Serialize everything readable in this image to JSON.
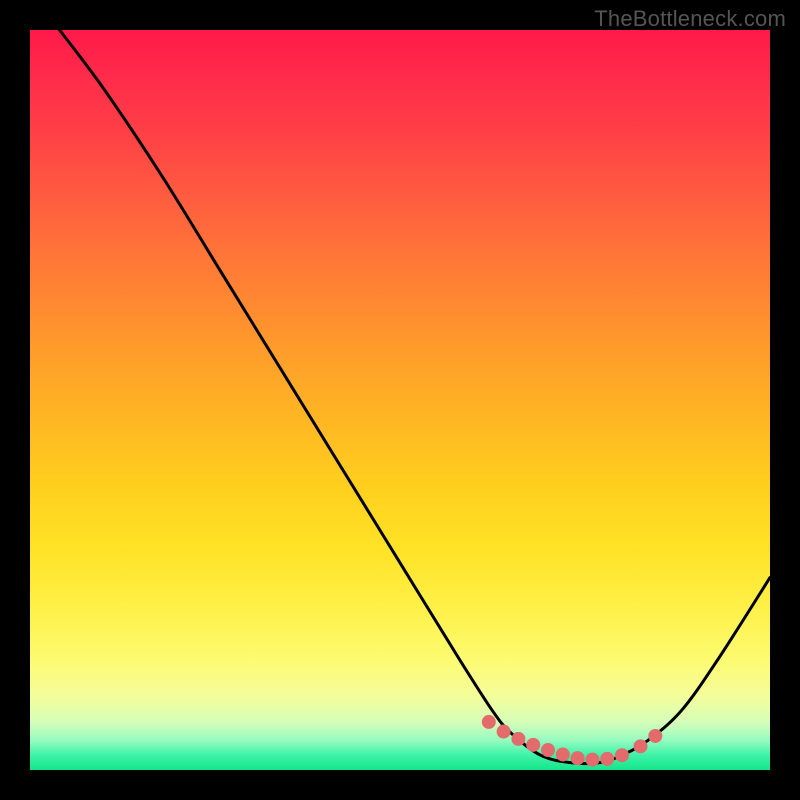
{
  "watermark": "TheBottleneck.com",
  "chart_data": {
    "type": "line",
    "title": "",
    "xlabel": "",
    "ylabel": "",
    "xlim": [
      0,
      100
    ],
    "ylim": [
      0,
      100
    ],
    "grid": false,
    "series": [
      {
        "name": "curve",
        "color": "#000000",
        "x": [
          4,
          10,
          18,
          26,
          34,
          42,
          50,
          58,
          62.5,
          65,
          69,
          73,
          77,
          80,
          83.5,
          88,
          93,
          100
        ],
        "values": [
          100,
          92,
          80,
          67,
          54,
          41,
          28,
          15,
          8,
          5,
          2,
          1,
          1,
          2,
          4,
          8,
          15,
          26
        ]
      }
    ],
    "markers": {
      "name": "highlight-dots",
      "color": "#e36b6b",
      "radius": 7,
      "x": [
        62,
        64,
        66,
        68,
        70,
        72,
        74,
        76,
        78,
        80,
        82.5,
        84.5
      ],
      "values": [
        6.5,
        5.2,
        4.2,
        3.4,
        2.7,
        2.1,
        1.6,
        1.4,
        1.5,
        2.0,
        3.2,
        4.6
      ]
    }
  }
}
